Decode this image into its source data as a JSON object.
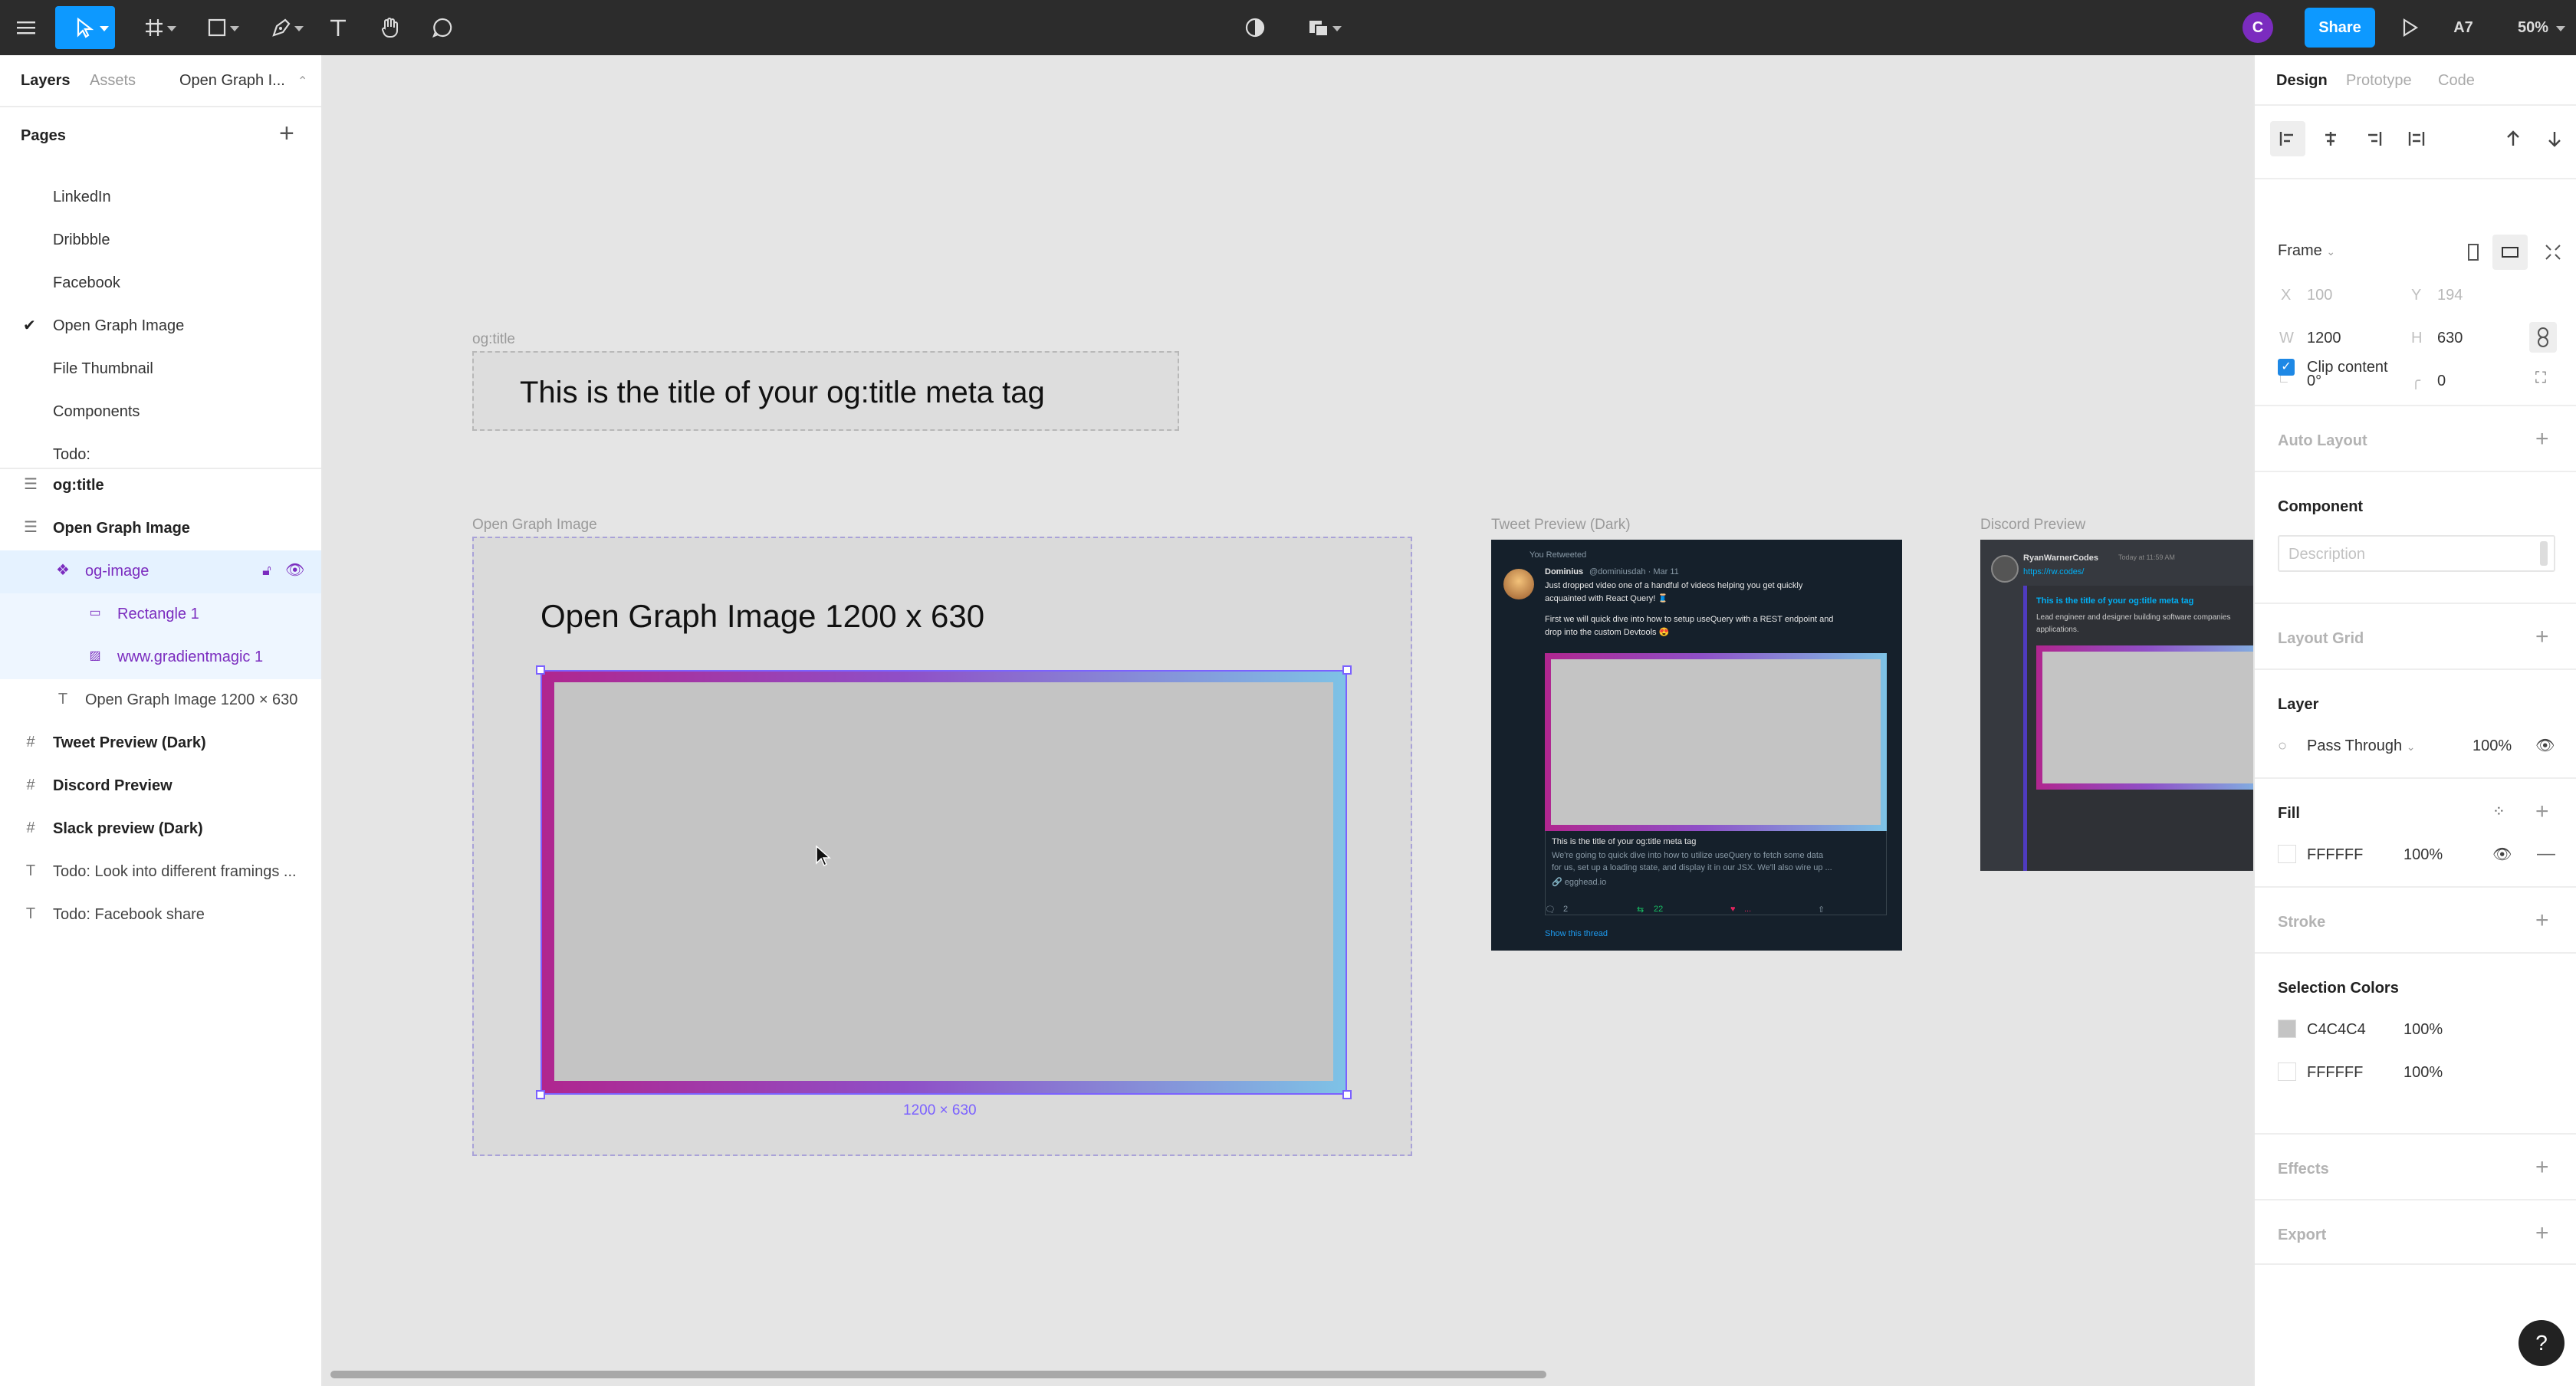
{
  "toolbar": {
    "share_label": "Share",
    "avatar_initial": "C",
    "user_badge": "A7",
    "zoom": "50%",
    "accent": "#0d99ff",
    "avatar_color": "#7b2cbf"
  },
  "left_panel": {
    "tabs": [
      "Layers",
      "Assets",
      "Open Graph I..."
    ],
    "pages_header": "Pages",
    "pages": [
      "LinkedIn",
      "Dribbble",
      "Facebook",
      "Open Graph Image",
      "File Thumbnail",
      "Components",
      "Todo:"
    ],
    "current_page": "Open Graph Image",
    "layers": [
      {
        "label": "og:title",
        "icon": "frame-stack-icon"
      },
      {
        "label": "Open Graph Image",
        "icon": "frame-stack-icon"
      },
      {
        "label": "og-image",
        "icon": "component-icon"
      },
      {
        "label": "Rectangle 1",
        "icon": "rectangle-icon"
      },
      {
        "label": "www.gradientmagic 1",
        "icon": "image-icon"
      },
      {
        "label": "Open Graph Image 1200 × 630",
        "icon": "text-icon"
      },
      {
        "label": "Tweet Preview (Dark)",
        "icon": "hash-frame-icon"
      },
      {
        "label": "Discord Preview",
        "icon": "hash-frame-icon"
      },
      {
        "label": "Slack preview (Dark)",
        "icon": "hash-frame-icon"
      },
      {
        "label": "Todo: Look into different framings ...",
        "icon": "text-icon"
      },
      {
        "label": "Todo: Facebook share",
        "icon": "text-icon"
      }
    ]
  },
  "canvas": {
    "og_title_frame_label": "og:title",
    "og_title_text": "This is the title of your og:title meta tag",
    "og_frame_label": "Open Graph Image",
    "og_heading": "Open Graph Image 1200 x 630",
    "selection_size": "1200 × 630",
    "tweet_frame_label": "Tweet Preview (Dark)",
    "discord_frame_label": "Discord Preview",
    "tweet": {
      "retweeted": "You Retweeted",
      "author": "Dominius",
      "handle": "@dominiusdah · Mar 11",
      "line1": "Just dropped video one of a handful of videos helping you get quickly",
      "line2": "acquainted with React Query! 🧵",
      "line3": "First we will quick dive into how to setup useQuery with a REST endpoint and",
      "line4": "drop into the custom Devtools 😍",
      "card_title": "This is the title of your og:title meta tag",
      "card_desc1": "We're going to quick dive into how to utilize useQuery to fetch some data",
      "card_desc2": "for us, set up a loading state, and display it in our JSX. We'll also wire up ...",
      "card_domain": "🔗 egghead.io",
      "replies": "2",
      "retweets": "22",
      "likes": "...",
      "show_thread": "Show this thread"
    },
    "discord": {
      "user": "RyanWarnerCodes",
      "time": "Today at 11:59 AM",
      "link": "https://rw.codes/",
      "embed_title": "This is the title of your og:title meta tag",
      "embed_desc1": "Lead engineer and designer building software companies",
      "embed_desc2": "applications."
    }
  },
  "right_panel": {
    "tabs": [
      "Design",
      "Prototype",
      "Code"
    ],
    "frame_label": "Frame",
    "x_label": "X",
    "x": "100",
    "y_label": "Y",
    "y": "194",
    "w_label": "W",
    "w": "1200",
    "h_label": "H",
    "h": "630",
    "rotation": "0°",
    "radius": "0",
    "clip_content": "Clip content",
    "auto_layout": "Auto Layout",
    "component": "Component",
    "description_placeholder": "Description",
    "layout_grid": "Layout Grid",
    "layer": "Layer",
    "blend": "Pass Through",
    "layer_opacity": "100%",
    "fill": "Fill",
    "fill_hex": "FFFFFF",
    "fill_opacity": "100%",
    "stroke": "Stroke",
    "selection_colors": "Selection Colors",
    "sel_colors": [
      {
        "hex": "C4C4C4",
        "opacity": "100%",
        "swatch": "#c4c4c4"
      },
      {
        "hex": "FFFFFF",
        "opacity": "100%",
        "swatch": "#ffffff"
      }
    ],
    "effects": "Effects",
    "export": "Export",
    "help": "?"
  }
}
